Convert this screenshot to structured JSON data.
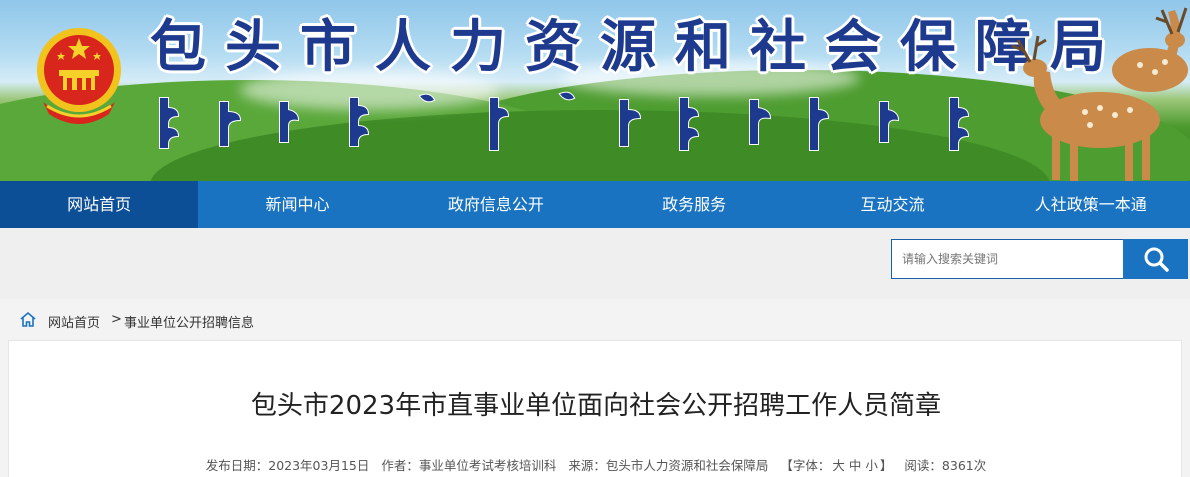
{
  "banner": {
    "title": "包头市人力资源和社会保障局",
    "emblem_icon": "national-emblem-icon",
    "mongolian_script_icon": "mongolian-script-title",
    "deer_icon": "deer-illustration"
  },
  "nav": {
    "items": [
      {
        "label": "网站首页",
        "active": true
      },
      {
        "label": "新闻中心",
        "active": false
      },
      {
        "label": "政府信息公开",
        "active": false
      },
      {
        "label": "政务服务",
        "active": false
      },
      {
        "label": "互动交流",
        "active": false
      },
      {
        "label": "人社政策一本通",
        "active": false
      }
    ]
  },
  "search": {
    "placeholder": "请输入搜索关键词",
    "button_icon": "search-icon"
  },
  "breadcrumb": {
    "home": "网站首页",
    "separator": ">",
    "current": "事业单位公开招聘信息"
  },
  "article": {
    "title": "包头市2023年市直事业单位面向社会公开招聘工作人员简章",
    "meta": {
      "date": "发布日期：2023年03月15日",
      "author": "作者：事业单位考试考核培训科",
      "source": "来源：包头市人力资源和社会保障局",
      "font_label": "【字体：",
      "font_large": "大",
      "font_medium": "中",
      "font_small": "小",
      "font_close": "】",
      "views": "阅读：8361次"
    }
  },
  "colors": {
    "nav_bg": "#1a73c1",
    "nav_active": "#0d4f96",
    "title_blue": "#1d3a8e"
  }
}
